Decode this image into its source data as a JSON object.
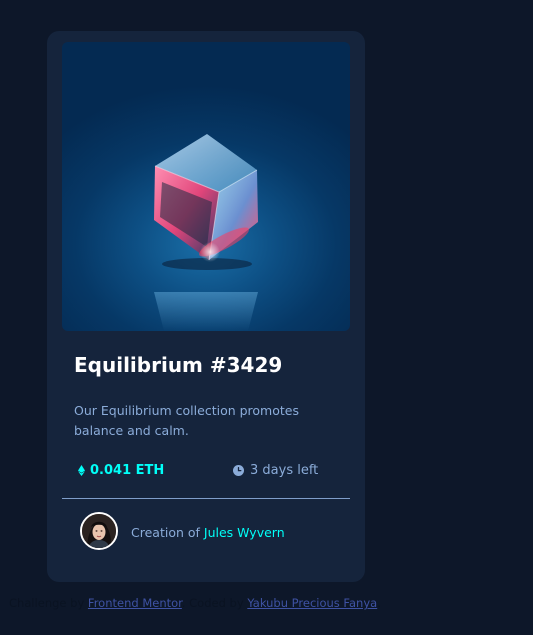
{
  "card": {
    "title": "Equilibrium #3429",
    "description": "Our Equilibrium collection promotes balance and calm.",
    "price": "0.041 ETH",
    "time_left": "3 days left",
    "creator_prefix": "Creation of",
    "creator_name": "Jules Wyvern",
    "image_alt": "equilibrium-cube-image"
  },
  "attribution": {
    "challenge_prefix": "Challenge by",
    "challenge_link": "Frontend Mentor",
    "coded_prefix": "Coded by",
    "coded_link": "Yakubu Precious Fanya"
  },
  "colors": {
    "background": "#0d1729",
    "card": "#15243c",
    "cyan": "#00fff8",
    "soft_blue": "#8bacd9",
    "white": "#ffffff"
  },
  "icons": {
    "price": "ethereum-icon",
    "time": "clock-icon"
  }
}
